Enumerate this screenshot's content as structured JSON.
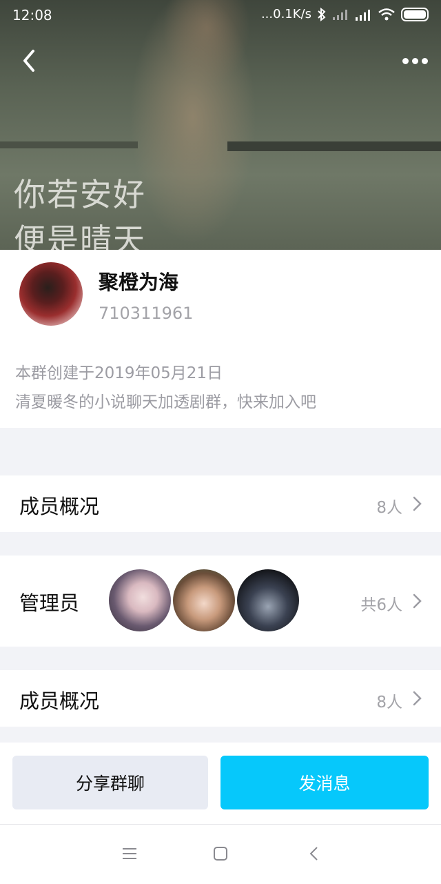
{
  "status_bar": {
    "time": "12:08",
    "network_speed": "...0.1K/s",
    "icons": [
      "bluetooth-icon",
      "signal-icon",
      "hd-signal-icon",
      "wifi-icon",
      "battery-icon"
    ]
  },
  "header": {
    "cover_caption_line1": "你若安好",
    "cover_caption_line2": "便是晴天",
    "back_icon": "chevron-left-icon",
    "more_icon": "more-icon"
  },
  "group": {
    "name": "聚橙为海",
    "id": "710311961",
    "created": "本群创建于2019年05月21日",
    "description": "清夏暖冬的小说聊天加透剧群，快来加入吧"
  },
  "rows": [
    {
      "label": "成员概况",
      "meta": "8人"
    },
    {
      "label": "管理员",
      "meta": "共6人"
    },
    {
      "label": "成员概况",
      "meta": "8人"
    }
  ],
  "actions": {
    "share": "分享群聊",
    "send": "发消息"
  },
  "colors": {
    "accent": "#06c8fb",
    "secondary_button": "#e8ebf3",
    "muted_text": "#a3a3a8",
    "background": "#f2f3f7"
  }
}
